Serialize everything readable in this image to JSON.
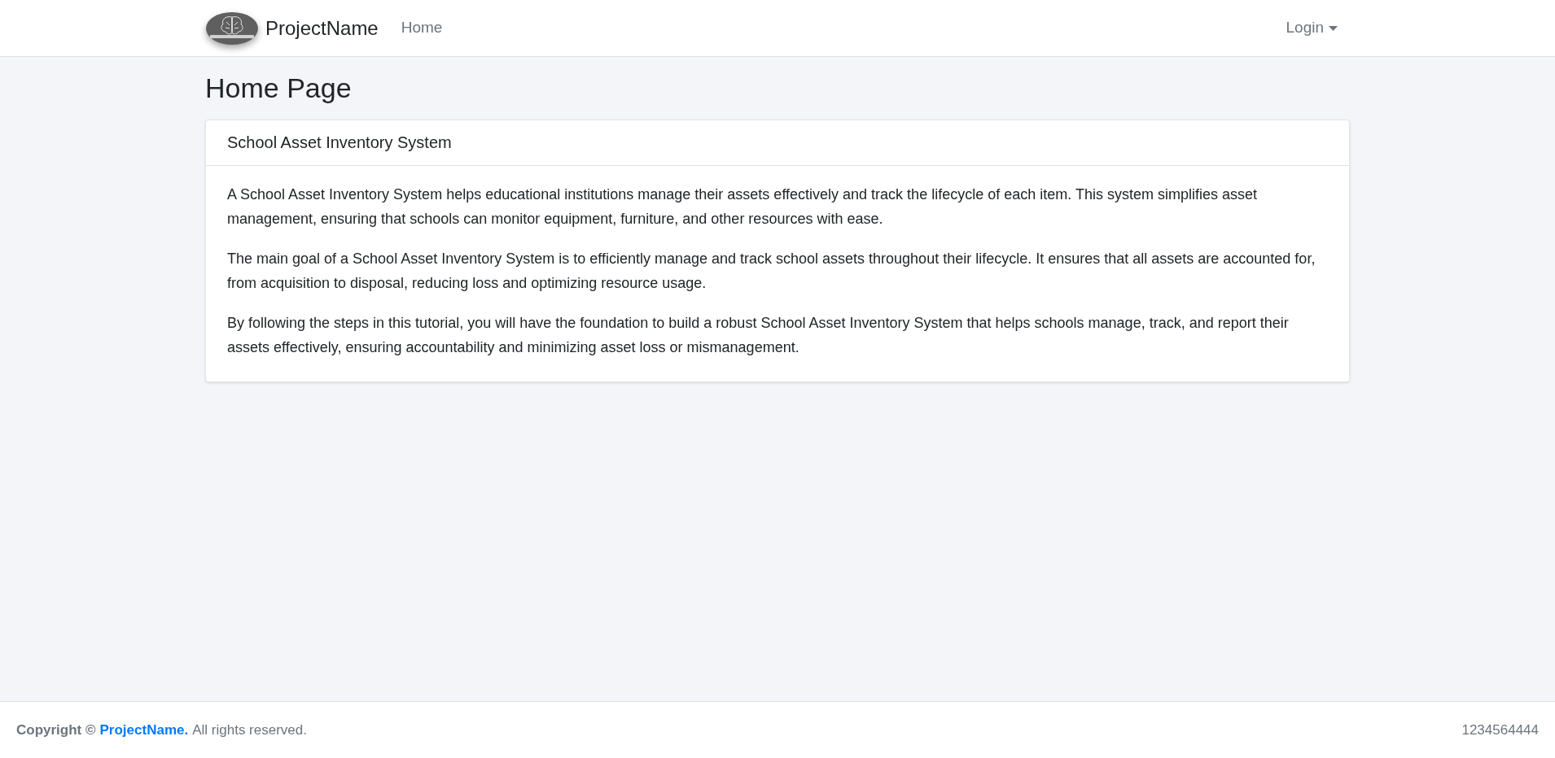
{
  "navbar": {
    "brand": "ProjectName",
    "links": [
      {
        "label": "Home",
        "selected": false
      }
    ],
    "login": "Login"
  },
  "page_title": "Home Page",
  "card": {
    "title": "School Asset Inventory System",
    "paragraphs": [
      "A School Asset Inventory System helps educational institutions manage their assets effectively and track the lifecycle of each item. This system simplifies asset management, ensuring that schools can monitor equipment, furniture, and other resources with ease.",
      "The main goal of a School Asset Inventory System is to efficiently manage and track school assets throughout their lifecycle. It ensures that all assets are accounted for, from acquisition to disposal, reducing loss and optimizing resource usage.",
      "By following the steps in this tutorial, you will have the foundation to build a robust School Asset Inventory System that helps schools manage, track, and report their assets effectively, ensuring accountability and minimizing asset loss or mismanagement."
    ]
  },
  "footer": {
    "copyright": "Copyright ©",
    "brand_link": "ProjectName.",
    "rights": "All rights reserved.",
    "phone": "1234564444"
  }
}
